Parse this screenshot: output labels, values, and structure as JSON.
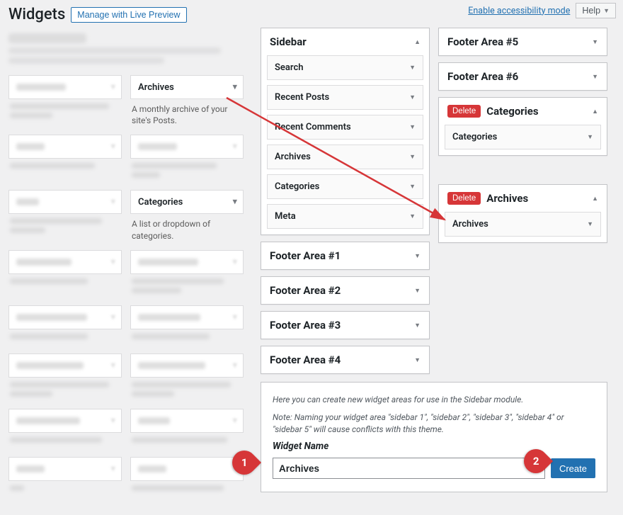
{
  "topbar": {
    "accessibility": "Enable accessibility mode",
    "help": "Help"
  },
  "header": {
    "title": "Widgets",
    "manage": "Manage with Live Preview"
  },
  "available": {
    "archives": {
      "title": "Archives",
      "desc": "A monthly archive of your site's Posts."
    },
    "categories": {
      "title": "Categories",
      "desc": "A list or dropdown of categories."
    }
  },
  "sidebar": {
    "title": "Sidebar",
    "items": [
      {
        "label": "Search"
      },
      {
        "label": "Recent Posts"
      },
      {
        "label": "Recent Comments"
      },
      {
        "label": "Archives"
      },
      {
        "label": "Categories"
      },
      {
        "label": "Meta"
      }
    ]
  },
  "footers": {
    "f1": "Footer Area #1",
    "f2": "Footer Area #2",
    "f3": "Footer Area #3",
    "f4": "Footer Area #4",
    "f5": "Footer Area #5",
    "f6": "Footer Area #6"
  },
  "categories_area": {
    "delete": "Delete",
    "title": "Categories",
    "item": "Categories"
  },
  "archives_area": {
    "delete": "Delete",
    "title": "Archives",
    "item": "Archives"
  },
  "create": {
    "note1": "Here you can create new widget areas for use in the Sidebar module.",
    "note2": "Note: Naming your widget area \"sidebar 1\", \"sidebar 2\", \"sidebar 3\", \"sidebar 4\" or \"sidebar 5\" will cause conflicts with this theme.",
    "label": "Widget Name",
    "value": "Archives",
    "button": "Create"
  },
  "steps": {
    "s1": "1",
    "s2": "2"
  }
}
